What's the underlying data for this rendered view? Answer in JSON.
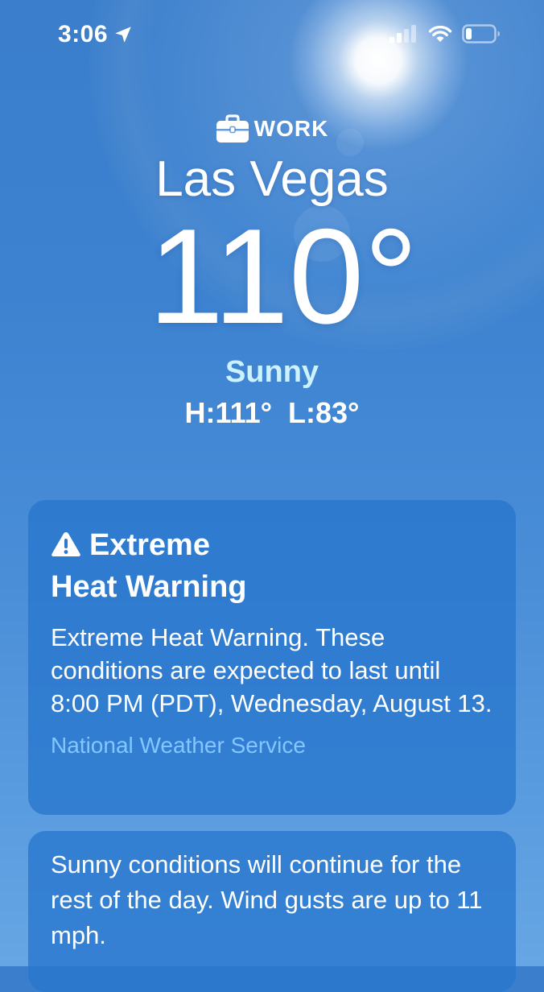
{
  "status_bar": {
    "time": "3:06"
  },
  "location": {
    "label": "WORK",
    "city": "Las Vegas",
    "temperature": "110°",
    "condition": "Sunny",
    "high_low": "H:111°  L:83°"
  },
  "alert": {
    "title_line1": "Extreme",
    "title_line2": "Heat Warning",
    "body": "Extreme Heat Warning. These conditions are expected to last until 8:00 PM (PDT), Wednesday, August 13.",
    "source": "National Weather Service"
  },
  "summary": {
    "text": "Sunny conditions will continue for the rest of the day. Wind gusts are up to 11 mph."
  },
  "colors": {
    "background": "#3c82d0",
    "condition_text": "#cdf2ff",
    "source_link": "#84c6ff"
  }
}
